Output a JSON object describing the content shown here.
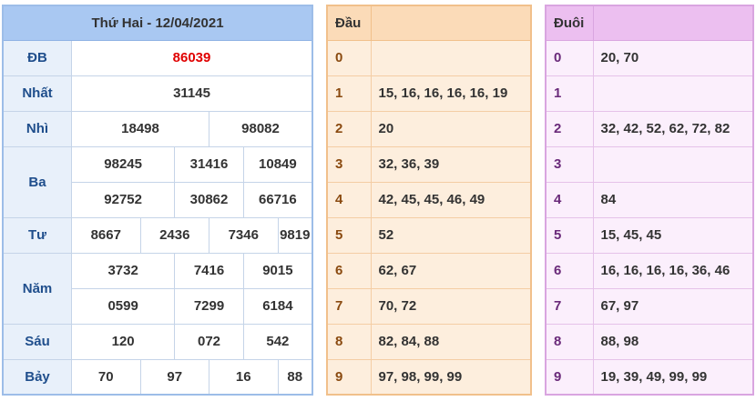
{
  "results": {
    "header": "Thứ Hai - 12/04/2021",
    "prizes": {
      "db": {
        "label": "ĐB",
        "values": [
          "86039"
        ]
      },
      "nhat": {
        "label": "Nhất",
        "values": [
          "31145"
        ]
      },
      "nhi": {
        "label": "Nhì",
        "values": [
          "18498",
          "98082"
        ]
      },
      "ba": {
        "label": "Ba",
        "values": [
          "98245",
          "31416",
          "10849",
          "92752",
          "30862",
          "66716"
        ]
      },
      "tu": {
        "label": "Tư",
        "values": [
          "8667",
          "2436",
          "7346",
          "9819"
        ]
      },
      "nam": {
        "label": "Năm",
        "values": [
          "3732",
          "7416",
          "9015",
          "0599",
          "7299",
          "6184"
        ]
      },
      "sau": {
        "label": "Sáu",
        "values": [
          "120",
          "072",
          "542"
        ]
      },
      "bay": {
        "label": "Bảy",
        "values": [
          "70",
          "97",
          "16",
          "88"
        ]
      }
    },
    "colors": {
      "special": "#e00000",
      "header_bg": "#a9c8f2"
    }
  },
  "dau": {
    "header": "Đầu",
    "rows": [
      {
        "digit": "0",
        "values": ""
      },
      {
        "digit": "1",
        "values": "15, 16, 16, 16, 16, 19"
      },
      {
        "digit": "2",
        "values": "20"
      },
      {
        "digit": "3",
        "values": "32, 36, 39"
      },
      {
        "digit": "4",
        "values": "42, 45, 45, 46, 49"
      },
      {
        "digit": "5",
        "values": "52"
      },
      {
        "digit": "6",
        "values": "62, 67"
      },
      {
        "digit": "7",
        "values": "70, 72"
      },
      {
        "digit": "8",
        "values": "82, 84, 88"
      },
      {
        "digit": "9",
        "values": "97, 98, 99, 99"
      }
    ]
  },
  "duoi": {
    "header": "Đuôi",
    "rows": [
      {
        "digit": "0",
        "values": "20, 70"
      },
      {
        "digit": "1",
        "values": ""
      },
      {
        "digit": "2",
        "values": "32, 42, 52, 62, 72, 82"
      },
      {
        "digit": "3",
        "values": ""
      },
      {
        "digit": "4",
        "values": "84"
      },
      {
        "digit": "5",
        "values": "15, 45, 45"
      },
      {
        "digit": "6",
        "values": "16, 16, 16, 16, 36, 46"
      },
      {
        "digit": "7",
        "values": "67, 97"
      },
      {
        "digit": "8",
        "values": "88, 98"
      },
      {
        "digit": "9",
        "values": "19, 39, 49, 99, 99"
      }
    ]
  }
}
